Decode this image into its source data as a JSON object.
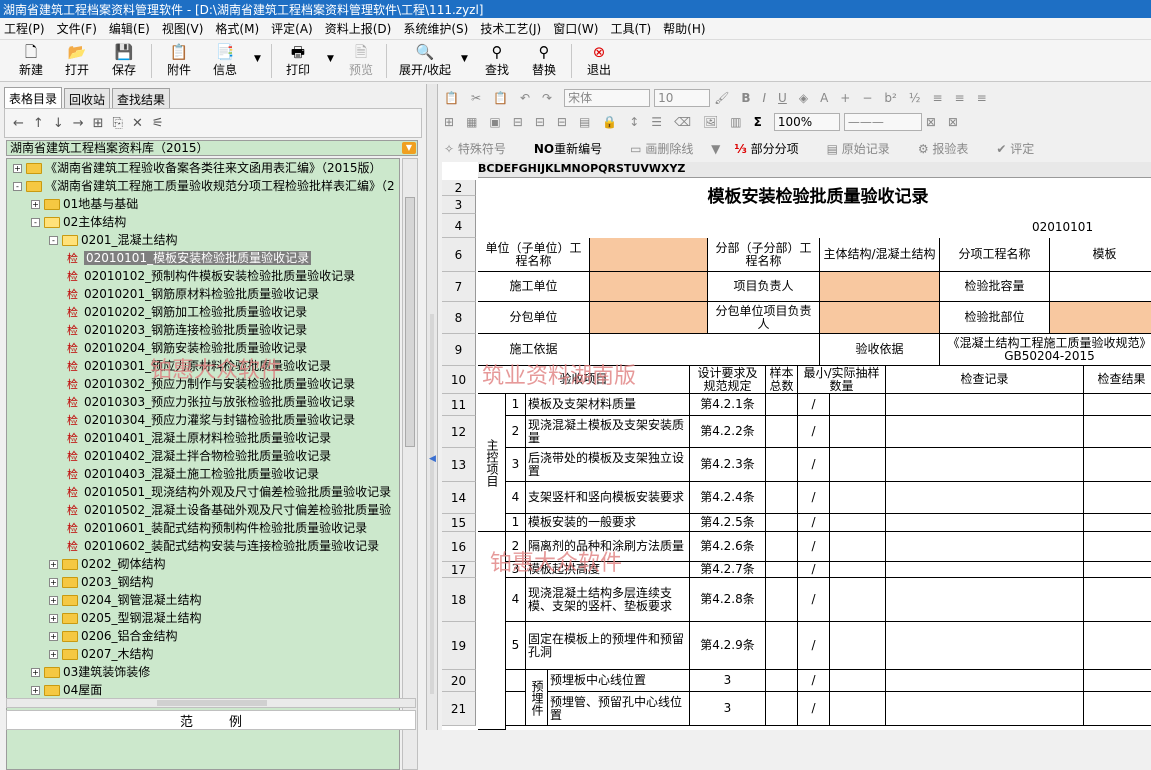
{
  "window": {
    "title": "湖南省建筑工程档案资料管理软件 - [D:\\湖南省建筑工程档案资料管理软件\\工程\\111.zyzl]"
  },
  "menu": [
    "工程(P)",
    "文件(F)",
    "编辑(E)",
    "视图(V)",
    "格式(M)",
    "评定(A)",
    "资料上报(D)",
    "系统维护(S)",
    "技术工艺(J)",
    "窗口(W)",
    "工具(T)",
    "帮助(H)"
  ],
  "toolbar": {
    "new": "新建",
    "open": "打开",
    "save": "保存",
    "attach": "附件",
    "info": "信息",
    "print": "打印",
    "preview": "预览",
    "expand": "展开/收起",
    "find": "查找",
    "replace": "替换",
    "exit": "退出"
  },
  "left": {
    "tabs": [
      "表格目录",
      "回收站",
      "查找结果"
    ],
    "library": "湖南省建筑工程档案资料库（2015）",
    "check_mark": "检",
    "tree": [
      {
        "label": "《湖南省建筑工程验收备案各类往来文函用表汇编》（2015版）",
        "level": 0,
        "type": "folder",
        "exp": "+"
      },
      {
        "label": "《湖南省建筑工程施工质量验收规范分项工程检验批样表汇编》（2",
        "level": 0,
        "type": "folder",
        "exp": "-"
      },
      {
        "label": "01地基与基础",
        "level": 1,
        "type": "folder",
        "exp": "+"
      },
      {
        "label": "02主体结构",
        "level": 1,
        "type": "folder-open",
        "exp": "-"
      },
      {
        "label": "0201_混凝土结构",
        "level": 2,
        "type": "folder-open",
        "exp": "-"
      },
      {
        "label": "02010101_模板安装检验批质量验收记录",
        "level": 3,
        "type": "item",
        "selected": true
      },
      {
        "label": "02010102_预制构件模板安装检验批质量验收记录",
        "level": 3,
        "type": "item"
      },
      {
        "label": "02010201_钢筋原材料检验批质量验收记录",
        "level": 3,
        "type": "item"
      },
      {
        "label": "02010202_钢筋加工检验批质量验收记录",
        "level": 3,
        "type": "item"
      },
      {
        "label": "02010203_钢筋连接检验批质量验收记录",
        "level": 3,
        "type": "item"
      },
      {
        "label": "02010204_钢筋安装检验批质量验收记录",
        "level": 3,
        "type": "item"
      },
      {
        "label": "02010301_预应力原材料检验批质量验收记录",
        "level": 3,
        "type": "item"
      },
      {
        "label": "02010302_预应力制作与安装检验批质量验收记录",
        "level": 3,
        "type": "item"
      },
      {
        "label": "02010303_预应力张拉与放张检验批质量验收记录",
        "level": 3,
        "type": "item"
      },
      {
        "label": "02010304_预应力灌浆与封锚检验批质量验收记录",
        "level": 3,
        "type": "item"
      },
      {
        "label": "02010401_混凝土原材料检验批质量验收记录",
        "level": 3,
        "type": "item"
      },
      {
        "label": "02010402_混凝土拌合物检验批质量验收记录",
        "level": 3,
        "type": "item"
      },
      {
        "label": "02010403_混凝土施工检验批质量验收记录",
        "level": 3,
        "type": "item"
      },
      {
        "label": "02010501_现浇结构外观及尺寸偏差检验批质量验收记录",
        "level": 3,
        "type": "item"
      },
      {
        "label": "02010502_混凝土设备基础外观及尺寸偏差检验批质量验",
        "level": 3,
        "type": "item"
      },
      {
        "label": "02010601_装配式结构预制构件检验批质量验收记录",
        "level": 3,
        "type": "item"
      },
      {
        "label": "02010602_装配式结构安装与连接检验批质量验收记录",
        "level": 3,
        "type": "item"
      },
      {
        "label": "0202_砌体结构",
        "level": 2,
        "type": "folder",
        "exp": "+"
      },
      {
        "label": "0203_钢结构",
        "level": 2,
        "type": "folder",
        "exp": "+"
      },
      {
        "label": "0204_钢管混凝土结构",
        "level": 2,
        "type": "folder",
        "exp": "+"
      },
      {
        "label": "0205_型钢混凝土结构",
        "level": 2,
        "type": "folder",
        "exp": "+"
      },
      {
        "label": "0206_铝合金结构",
        "level": 2,
        "type": "folder",
        "exp": "+"
      },
      {
        "label": "0207_木结构",
        "level": 2,
        "type": "folder",
        "exp": "+"
      },
      {
        "label": "03建筑装饰装修",
        "level": 1,
        "type": "folder",
        "exp": "+"
      },
      {
        "label": "04屋面",
        "level": 1,
        "type": "folder",
        "exp": "+"
      }
    ],
    "example_label": "范例"
  },
  "format_bar": {
    "font": "宋体",
    "size": "10",
    "zoom": "100%",
    "bold": "B",
    "italic": "I",
    "underline": "U",
    "sigma": "Σ",
    "special_symbol": "特殊符号",
    "renumber_prefix": "NO",
    "renumber": "重新编号",
    "draw_line": "画删除线",
    "partial": "部分分项",
    "original_record": "原始记录",
    "report_check": "报验表",
    "evaluate": "评定"
  },
  "sheet": {
    "column_letters": "BCDEFGHIJKLMNOPQRSTUVWXYZ",
    "title": "模板安装检验批质量验收记录",
    "code": "02010101",
    "row_numbers": [
      "2",
      "3",
      "4",
      "6",
      "7",
      "8",
      "9",
      "10",
      "11",
      "12",
      "13",
      "14",
      "15",
      "16",
      "17",
      "18",
      "19",
      "20",
      "21"
    ],
    "labels": {
      "unit": "单位（子单位）工程名称",
      "division": "分部（子分部）工程名称",
      "division_val": "主体结构/混凝土结构",
      "item_name": "分项工程名称",
      "item_val": "模板",
      "contractor": "施工单位",
      "pm": "项目负责人",
      "capacity": "检验批容量",
      "sub": "分包单位",
      "sub_pm": "分包单位项目负责人",
      "location": "检验批部位",
      "basis": "施工依据",
      "accept_basis": "验收依据",
      "accept_std": "《混凝土结构工程施工质量验收规范》GB50204-2015",
      "check_item": "验收项目",
      "design_req": "设计要求及规范规定",
      "sample_total": "样本总数",
      "min_sample": "最小/实际抽样数量",
      "check_record": "检查记录",
      "check_result": "检查结果",
      "main_items": "主控项目",
      "embedded": "预埋件"
    },
    "rows": [
      {
        "no": "1",
        "item": "模板及支架材料质量",
        "clause": "第4.2.1条",
        "slash": "/"
      },
      {
        "no": "2",
        "item": "现浇混凝土模板及支架安装质量",
        "clause": "第4.2.2条",
        "slash": "/"
      },
      {
        "no": "3",
        "item": "后浇带处的模板及支架独立设置",
        "clause": "第4.2.3条",
        "slash": "/"
      },
      {
        "no": "4",
        "item": "支架竖杆和竖向模板安装要求",
        "clause": "第4.2.4条",
        "slash": "/"
      },
      {
        "no": "1",
        "item": "模板安装的一般要求",
        "clause": "第4.2.5条",
        "slash": "/"
      },
      {
        "no": "2",
        "item": "隔离剂的品种和涂刷方法质量",
        "clause": "第4.2.6条",
        "slash": "/"
      },
      {
        "no": "3",
        "item": "模板起拱高度",
        "clause": "第4.2.7条",
        "slash": "/"
      },
      {
        "no": "4",
        "item": "现浇混凝土结构多层连续支模、支架的竖杆、垫板要求",
        "clause": "第4.2.8条",
        "slash": "/"
      },
      {
        "no": "5",
        "item": "固定在模板上的预埋件和预留孔洞",
        "clause": "第4.2.9条",
        "slash": "/"
      },
      {
        "no": "",
        "item": "预埋板中心线位置",
        "clause": "3",
        "slash": "/"
      },
      {
        "no": "",
        "item": "预埋管、预留孔中心线位置",
        "clause": "3",
        "slash": "/"
      }
    ]
  },
  "watermarks": [
    "铂惠大众软件",
    "筑业资料湖南版",
    "铂惠大众软件"
  ]
}
